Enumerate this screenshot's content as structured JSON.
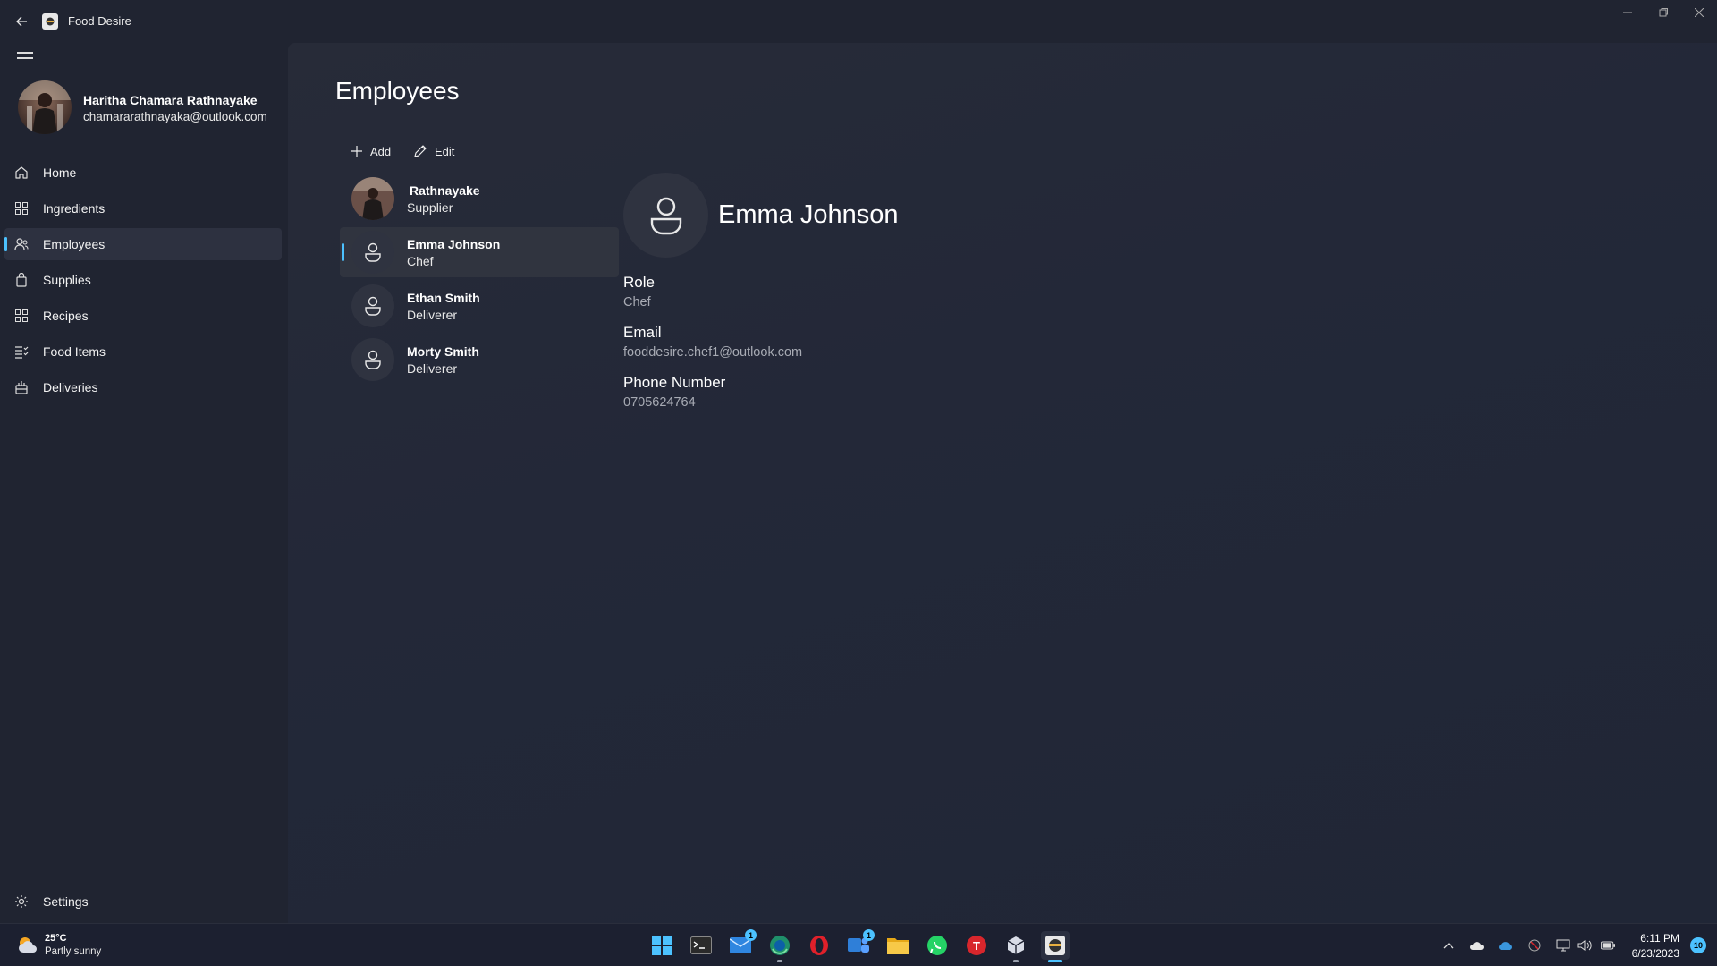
{
  "window": {
    "title": "Food Desire",
    "icons": {
      "back": "back-arrow-icon",
      "app": "food-desire-logo-icon",
      "minimize": "minimize-icon",
      "maximize": "maximize-icon",
      "close": "close-icon"
    }
  },
  "sidebar": {
    "menu_icon": "hamburger-menu-icon",
    "profile": {
      "name": "Haritha Chamara Rathnayake",
      "email": "chamararathnayaka@outlook.com"
    },
    "items": [
      {
        "label": "Home",
        "icon": "home-icon",
        "active": false
      },
      {
        "label": "Ingredients",
        "icon": "grid-icon",
        "active": false
      },
      {
        "label": "Employees",
        "icon": "people-icon",
        "active": true
      },
      {
        "label": "Supplies",
        "icon": "bag-icon",
        "active": false
      },
      {
        "label": "Recipes",
        "icon": "grid-icon",
        "active": false
      },
      {
        "label": "Food Items",
        "icon": "list-icon",
        "active": false
      },
      {
        "label": "Deliveries",
        "icon": "delivery-icon",
        "active": false
      }
    ],
    "settings_label": "Settings"
  },
  "main": {
    "title": "Employees",
    "commands": {
      "add_label": "Add",
      "edit_label": "Edit"
    },
    "employees": [
      {
        "name": "Rathnayake",
        "role": "Supplier",
        "photo": true,
        "selected": false
      },
      {
        "name": "Emma Johnson",
        "role": "Chef",
        "photo": false,
        "selected": true
      },
      {
        "name": "Ethan Smith",
        "role": "Deliverer",
        "photo": false,
        "selected": false
      },
      {
        "name": "Morty Smith",
        "role": "Deliverer",
        "photo": false,
        "selected": false
      }
    ],
    "detail": {
      "name": "Emma Johnson",
      "role_label": "Role",
      "role_value": "Chef",
      "email_label": "Email",
      "email_value": "fooddesire.chef1@outlook.com",
      "phone_label": "Phone Number",
      "phone_value": "0705624764"
    }
  },
  "taskbar": {
    "weather": {
      "temp": "25°C",
      "condition": "Partly sunny"
    },
    "apps": [
      {
        "name": "start-icon"
      },
      {
        "name": "terminal-icon"
      },
      {
        "name": "mail-icon",
        "badge": "1"
      },
      {
        "name": "edge-dev-icon",
        "running": true
      },
      {
        "name": "opera-icon"
      },
      {
        "name": "teams-icon",
        "badge": "1"
      },
      {
        "name": "file-explorer-icon"
      },
      {
        "name": "whatsapp-icon"
      },
      {
        "name": "todoist-icon",
        "letter": "T"
      },
      {
        "name": "package-icon",
        "running": true
      },
      {
        "name": "food-desire-app-icon",
        "running": true,
        "active": true
      }
    ],
    "clock": {
      "time": "6:11 PM",
      "date": "6/23/2023"
    },
    "notifications": "10"
  },
  "colors": {
    "accent": "#4cc2ff",
    "background": "#202431",
    "panel": "#272b38",
    "muted_text": "#a8abb4"
  }
}
